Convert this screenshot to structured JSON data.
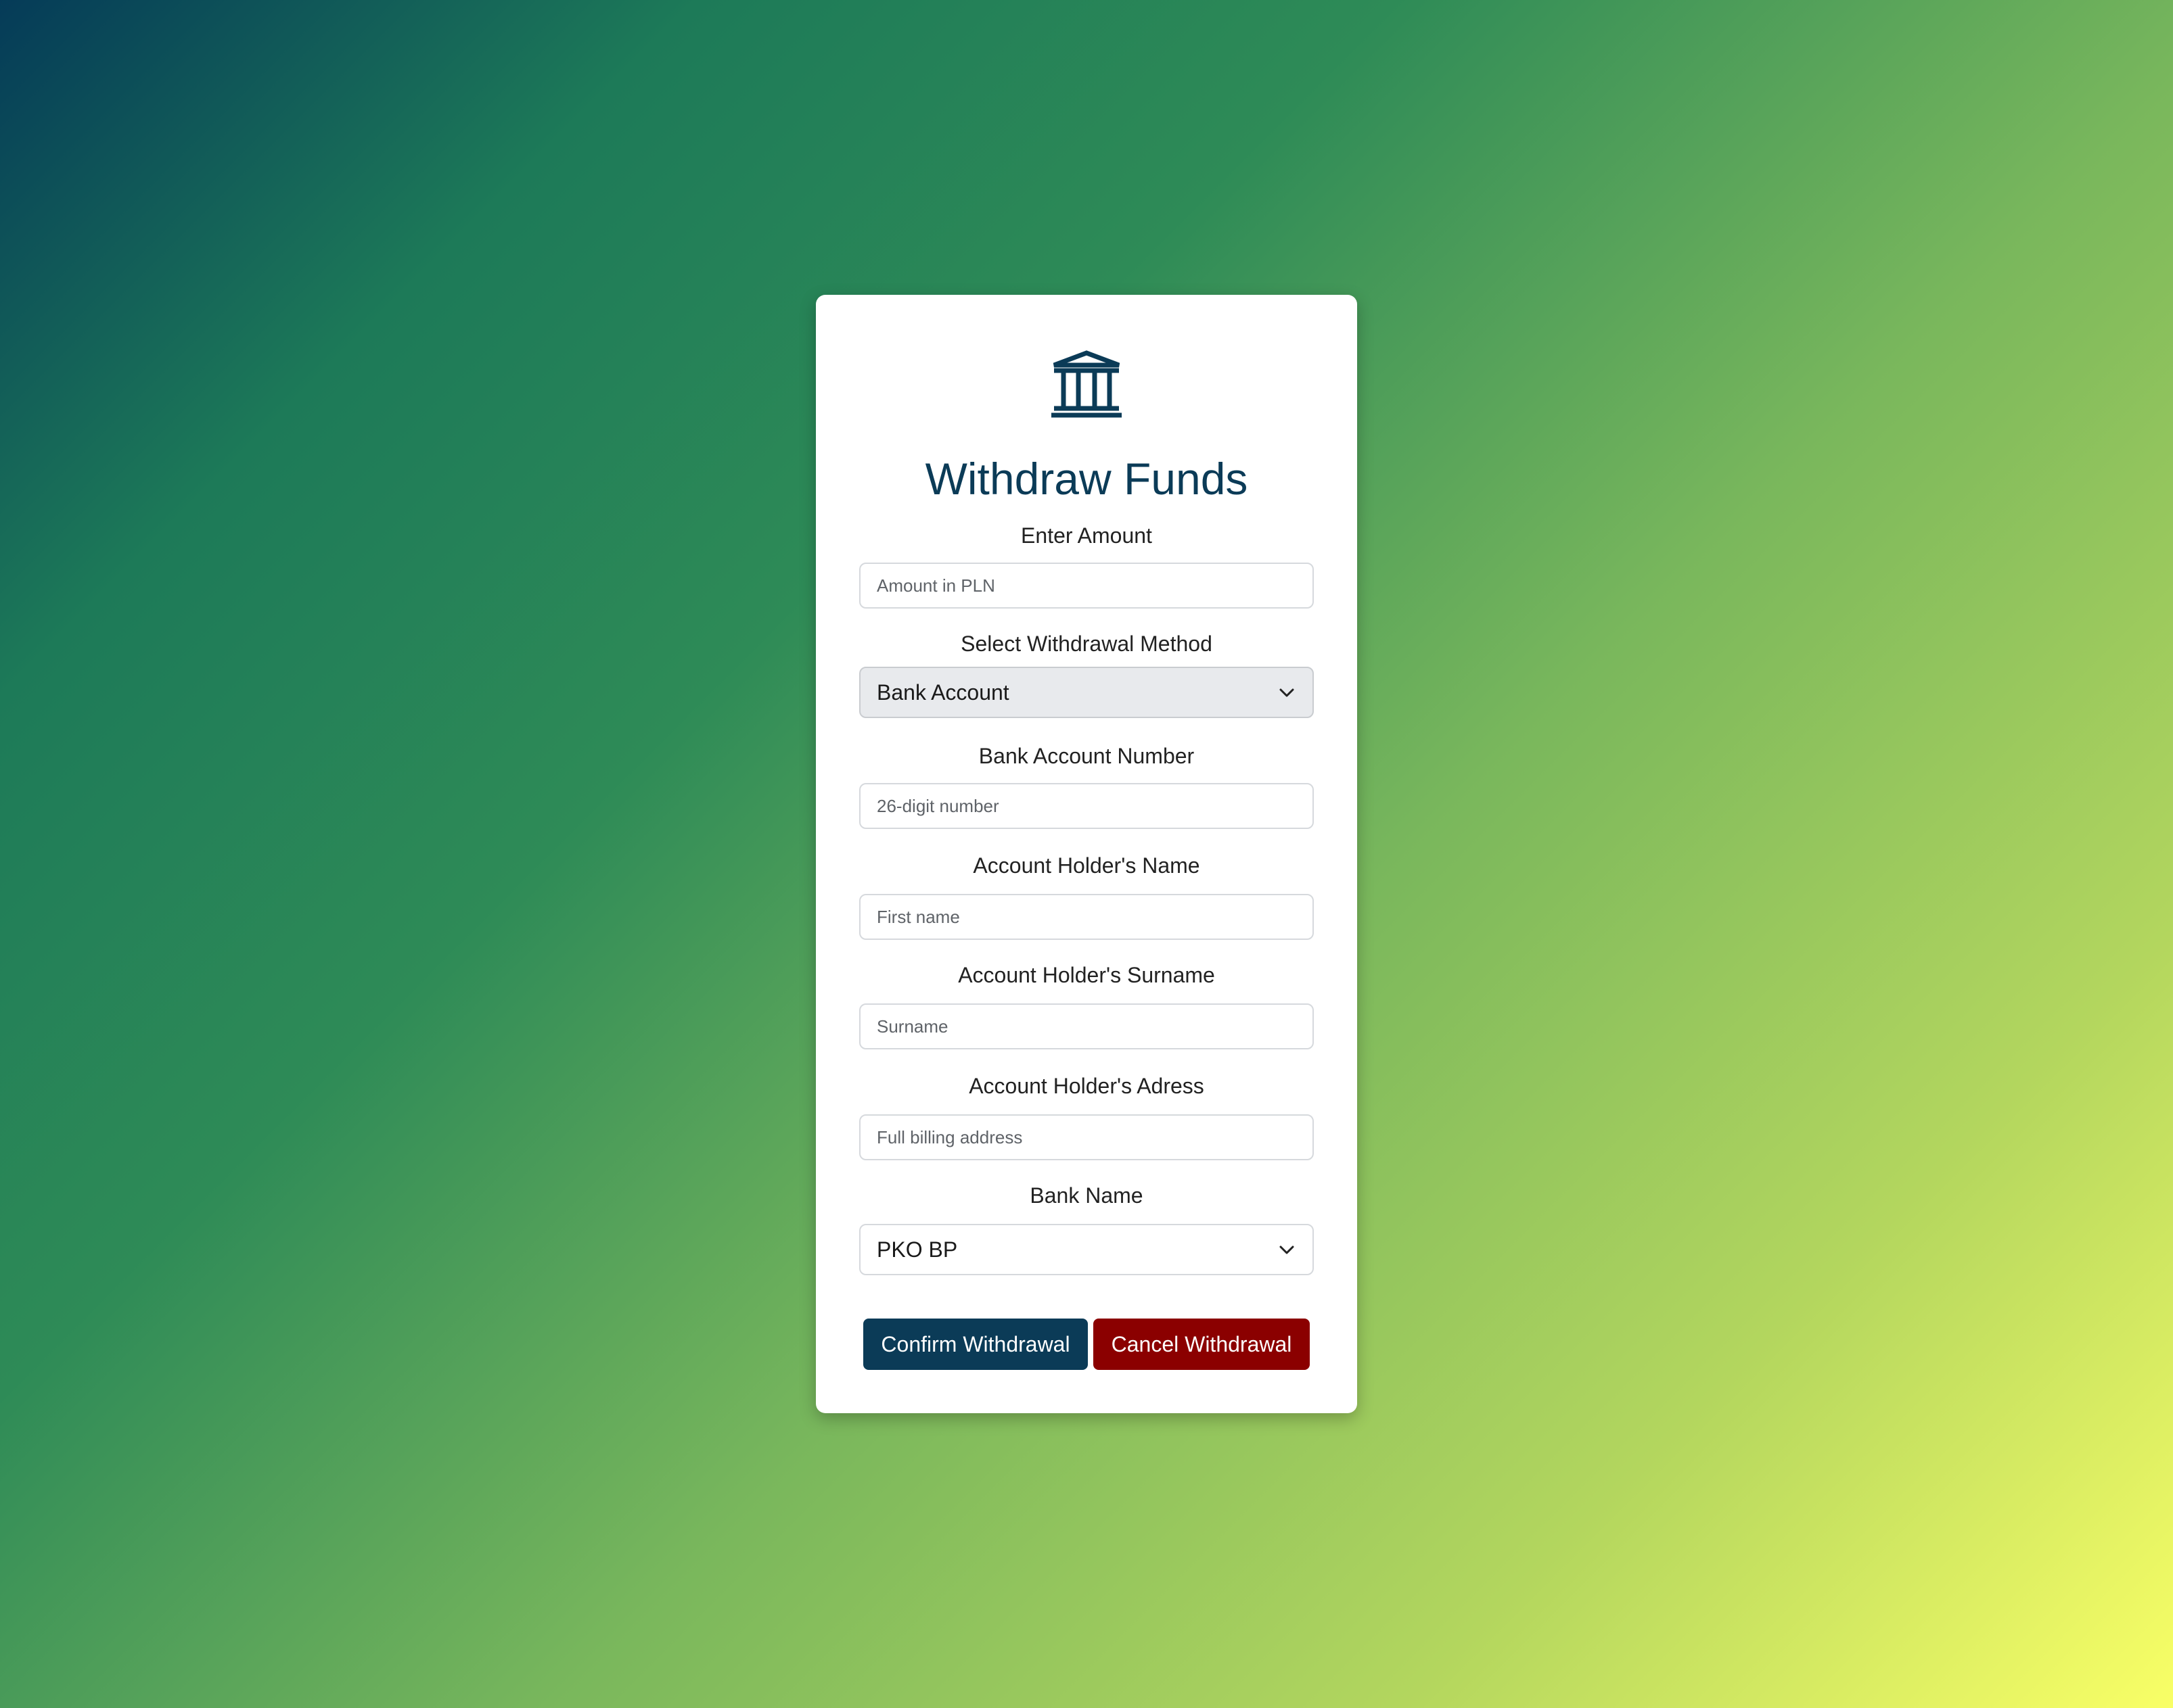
{
  "form": {
    "icon": "bank-icon",
    "title": "Withdraw Funds",
    "amount": {
      "label": "Enter Amount",
      "placeholder": "Amount in PLN",
      "value": ""
    },
    "method": {
      "label": "Select Withdrawal Method",
      "selected": "Bank Account"
    },
    "account_number": {
      "label": "Bank Account Number",
      "placeholder": "26-digit number",
      "value": ""
    },
    "holder_name": {
      "label": "Account Holder's Name",
      "placeholder": "First name",
      "value": ""
    },
    "holder_surname": {
      "label": "Account Holder's Surname",
      "placeholder": "Surname",
      "value": ""
    },
    "holder_address": {
      "label": "Account Holder's Adress",
      "placeholder": "Full billing address",
      "value": ""
    },
    "bank_name": {
      "label": "Bank Name",
      "selected": "PKO BP"
    },
    "confirm_label": "Confirm Withdrawal",
    "cancel_label": "Cancel Withdrawal"
  },
  "colors": {
    "primary": "#0b3b57",
    "danger": "#8b0000",
    "card": "#ffffff"
  }
}
